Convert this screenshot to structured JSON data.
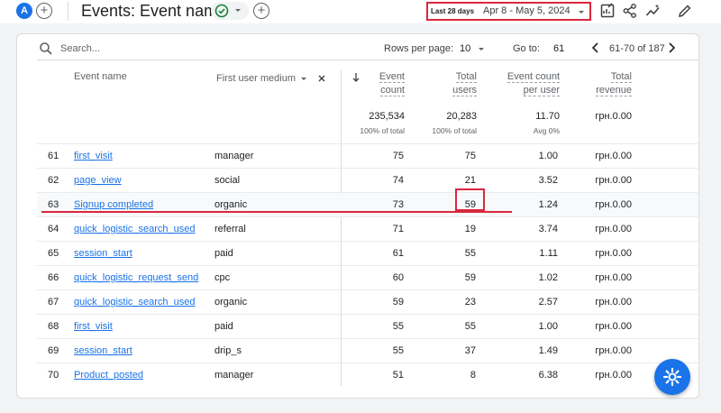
{
  "header": {
    "avatar_letter": "A",
    "title": "Events: Event name",
    "date_range_label": "Last 28 days",
    "date_range_value": "Apr 8 - May 5, 2024",
    "icons": [
      "add-icon",
      "check-circle-icon",
      "chevron-down-icon",
      "edit-report-icon",
      "share-icon",
      "insights-icon",
      "pencil-icon"
    ]
  },
  "toolbar": {
    "search_placeholder": "Search...",
    "rows_per_page_label": "Rows per page:",
    "rows_per_page_value": "10",
    "goto_label": "Go to:",
    "goto_value": "61",
    "page_range": "61-70 of 187"
  },
  "columns": {
    "event_name": "Event name",
    "dimension_selector": "First user medium",
    "event_count": [
      "Event",
      "count"
    ],
    "total_users": [
      "Total",
      "users"
    ],
    "event_count_per_user": [
      "Event count",
      "per user"
    ],
    "total_revenue": [
      "Total",
      "revenue"
    ]
  },
  "totals": {
    "event_count": "235,534",
    "event_count_sub": "100% of total",
    "total_users": "20,283",
    "total_users_sub": "100% of total",
    "event_count_per_user": "11.70",
    "event_count_per_user_sub": "Avg 0%",
    "total_revenue": "грн.0.00"
  },
  "rows": [
    {
      "idx": "61",
      "event": "first_visit",
      "medium": "manager",
      "count": "75",
      "users": "75",
      "per_user": "1.00",
      "revenue": "грн.0.00"
    },
    {
      "idx": "62",
      "event": "page_view",
      "medium": "social",
      "count": "74",
      "users": "21",
      "per_user": "3.52",
      "revenue": "грн.0.00"
    },
    {
      "idx": "63",
      "event": "Signup completed",
      "medium": "organic",
      "count": "73",
      "users": "59",
      "per_user": "1.24",
      "revenue": "грн.0.00"
    },
    {
      "idx": "64",
      "event": "quick_logistic_search_used",
      "medium": "referral",
      "count": "71",
      "users": "19",
      "per_user": "3.74",
      "revenue": "грн.0.00"
    },
    {
      "idx": "65",
      "event": "session_start",
      "medium": "paid",
      "count": "61",
      "users": "55",
      "per_user": "1.11",
      "revenue": "грн.0.00"
    },
    {
      "idx": "66",
      "event": "quick_logistic_request_send",
      "medium": "cpc",
      "count": "60",
      "users": "59",
      "per_user": "1.02",
      "revenue": "грн.0.00"
    },
    {
      "idx": "67",
      "event": "quick_logistic_search_used",
      "medium": "organic",
      "count": "59",
      "users": "23",
      "per_user": "2.57",
      "revenue": "грн.0.00"
    },
    {
      "idx": "68",
      "event": "first_visit",
      "medium": "paid",
      "count": "55",
      "users": "55",
      "per_user": "1.00",
      "revenue": "грн.0.00"
    },
    {
      "idx": "69",
      "event": "session_start",
      "medium": "drip_s",
      "count": "55",
      "users": "37",
      "per_user": "1.49",
      "revenue": "грн.0.00"
    },
    {
      "idx": "70",
      "event": "Product_posted",
      "medium": "manager",
      "count": "51",
      "users": "8",
      "per_user": "6.38",
      "revenue": "грн.0.00"
    }
  ],
  "colors": {
    "accent": "#1a73e8",
    "annotation_red": "#d9283e",
    "success_green": "#188038"
  }
}
